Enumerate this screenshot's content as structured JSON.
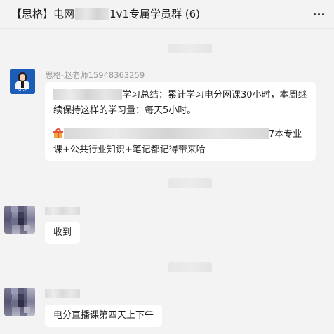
{
  "header": {
    "title_prefix": "【思格】电网",
    "title_suffix": "1v1专属学员群 (6)"
  },
  "messages": [
    {
      "sender": "思格-赵老师15948363259",
      "avatar_text": "SIGE",
      "line1_text": "学习总结：累计学习电分网课30小时，本周继续保持这样的学习量：每天5小时。",
      "line2_end": "7本专业",
      "line2_rest": "课+公共行业知识+笔记都记得带来哈"
    },
    {
      "text": "收到"
    },
    {
      "text": "电分直播课第四天上下午"
    }
  ],
  "icons": {
    "more": "more-icon",
    "gift": "gift-icon"
  }
}
